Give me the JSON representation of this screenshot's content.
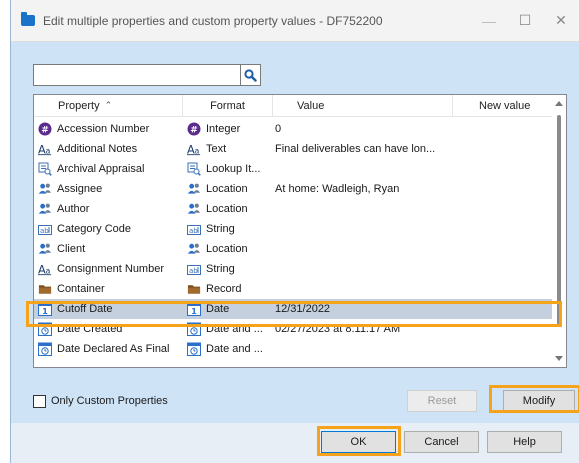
{
  "window": {
    "title": "Edit multiple properties and custom property values - DF752200",
    "minimize": "—",
    "maximize": "☐",
    "close": "✕"
  },
  "search": {
    "value": "",
    "placeholder": ""
  },
  "columns": {
    "property": "Property",
    "format": "Format",
    "value": "Value",
    "new_value": "New value"
  },
  "rows": [
    {
      "property": "Accession Number",
      "prop_icon": "number-icon",
      "format": "Integer",
      "format_icon": "number-icon",
      "value": "0",
      "selected": false
    },
    {
      "property": "Additional Notes",
      "prop_icon": "text-icon",
      "format": "Text",
      "format_icon": "text-icon",
      "value": "Final deliverables can have lon...",
      "selected": false
    },
    {
      "property": "Archival Appraisal",
      "prop_icon": "lookup-icon",
      "format": "Lookup It...",
      "format_icon": "lookup-icon",
      "value": "",
      "selected": false
    },
    {
      "property": "Assignee",
      "prop_icon": "location-icon",
      "format": "Location",
      "format_icon": "location-icon",
      "value": "At home: Wadleigh, Ryan",
      "selected": false
    },
    {
      "property": "Author",
      "prop_icon": "location-icon",
      "format": "Location",
      "format_icon": "location-icon",
      "value": "",
      "selected": false
    },
    {
      "property": "Category Code",
      "prop_icon": "string-icon",
      "format": "String",
      "format_icon": "string-icon",
      "value": "",
      "selected": false
    },
    {
      "property": "Client",
      "prop_icon": "location-icon",
      "format": "Location",
      "format_icon": "location-icon",
      "value": "",
      "selected": false
    },
    {
      "property": "Consignment Number",
      "prop_icon": "text-icon",
      "format": "String",
      "format_icon": "string-icon",
      "value": "",
      "selected": false
    },
    {
      "property": "Container",
      "prop_icon": "record-icon",
      "format": "Record",
      "format_icon": "record-icon",
      "value": "",
      "selected": false
    },
    {
      "property": "Cutoff Date",
      "prop_icon": "date-icon",
      "format": "Date",
      "format_icon": "date-icon",
      "value": "12/31/2022",
      "selected": true
    },
    {
      "property": "Date Created",
      "prop_icon": "datetime-icon",
      "format": "Date and ...",
      "format_icon": "datetime-icon",
      "value": "02/27/2023 at 8:11:17 AM",
      "selected": false
    },
    {
      "property": "Date Declared As Final",
      "prop_icon": "datetime-icon",
      "format": "Date and ...",
      "format_icon": "datetime-icon",
      "value": "",
      "selected": false
    }
  ],
  "only_custom_label": "Only Custom Properties",
  "buttons": {
    "reset": "Reset",
    "modify": "Modify",
    "ok": "OK",
    "cancel": "Cancel",
    "help": "Help"
  },
  "colors": {
    "highlight": "#f5a31a",
    "selected_row": "#c4d0de",
    "number_icon": "#5a2a8c",
    "location_icon": "#2a6fc9"
  }
}
